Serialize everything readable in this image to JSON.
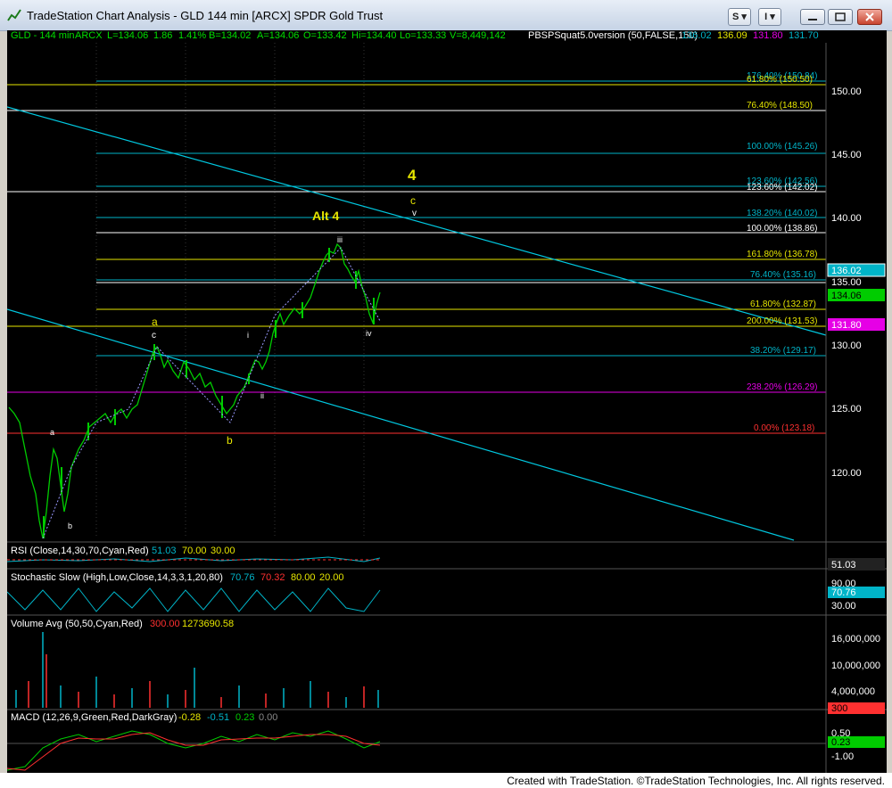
{
  "window": {
    "title": "TradeStation Chart Analysis - GLD 144 min [ARCX] SPDR Gold Trust",
    "s_button": "S",
    "i_button": "I"
  },
  "header": {
    "symbol": "GLD - 144 min",
    "exchange": "ARCX",
    "last": "L=134.06",
    "chg": "1.86",
    "pct": "1.41%",
    "bid": "B=134.02",
    "ask": "A=134.06",
    "open": "O=133.42",
    "high": "Hi=134.40",
    "low": "Lo=133.33",
    "volume": "V=8,449,142",
    "study": "PBSPSquat5.0version (50,FALSE,150)",
    "v1": "136.02",
    "v2": "136.09",
    "v3": "131.80",
    "v4": "131.70"
  },
  "colors": {
    "up": "#00cc00",
    "cyan": "#00b4c8",
    "yellow": "#e6e600",
    "magenta": "#e600e6",
    "red": "#ff3030",
    "white": "#ffffff"
  },
  "price_axis": [
    "150.00",
    "145.00",
    "140.00",
    "135.00",
    "130.00",
    "125.00",
    "120.00"
  ],
  "fib_labels": [
    {
      "text": "176.40% (150.84)",
      "color": "#00b4c8"
    },
    {
      "text": "61.80% (150.50)",
      "color": "#e6e600"
    },
    {
      "text": "76.40% (148.50)",
      "color": "#e6e600"
    },
    {
      "text": "100.00% (145.26)",
      "color": "#00b4c8"
    },
    {
      "text": "123.60% (142.56)",
      "color": "#00b4c8"
    },
    {
      "text": "123.60% (142.02)",
      "color": "#ffffff"
    },
    {
      "text": "138.20% (140.02)",
      "color": "#00b4c8"
    },
    {
      "text": "100.00% (138.86)",
      "color": "#ffffff"
    },
    {
      "text": "161.80% (136.78)",
      "color": "#e6e600"
    },
    {
      "text": "76.40% (135.16)",
      "color": "#00b4c8"
    },
    {
      "text": "61.80% (132.87)",
      "color": "#e6e600"
    },
    {
      "text": "200.00% (131.53)",
      "color": "#e6e600"
    },
    {
      "text": "38.20% (129.17)",
      "color": "#00b4c8"
    },
    {
      "text": "238.20% (126.29)",
      "color": "#e600e6"
    },
    {
      "text": "0.00% (123.18)",
      "color": "#ff3030"
    }
  ],
  "wave_labels": {
    "big_4": "4",
    "c_upper": "c",
    "v_upper": "v",
    "alt_4": "Alt 4",
    "iii": "iii",
    "iv": "iv",
    "i": "i",
    "ii": "ii",
    "a_yellow": "a",
    "c_white": "c",
    "b_yellow": "b",
    "a_small": "a",
    "b_small": "b"
  },
  "price_tags": {
    "tag1": "136.02",
    "tag2": "134.06",
    "tag3": "131.80"
  },
  "rsi": {
    "label": "RSI (Close,14,30,70,Cyan,Red)",
    "value": "51.03",
    "ob": "70.00",
    "os": "30.00",
    "tag": "51.03"
  },
  "stoch": {
    "label": "Stochastic Slow (High,Low,Close,14,3,3,1,20,80)",
    "k": "70.76",
    "d": "70.32",
    "ob": "80.00",
    "os": "20.00",
    "axis_90": "90.00",
    "tag": "70.76",
    "axis_30": "30.00"
  },
  "volume": {
    "label": "Volume Avg (50,50,Cyan,Red)",
    "v1": "300.00",
    "v2": "1273690.58",
    "axis": [
      "16,000,000",
      "10,000,000",
      "4,000,000"
    ],
    "tag": "300"
  },
  "macd": {
    "label": "MACD (12,26,9,Green,Red,DarkGray)",
    "m": "-0.28",
    "s": "-0.51",
    "h": "0.23",
    "z": "0.00",
    "axis_top": "0.50",
    "tag": "0.23",
    "axis_bottom": "-1.00"
  },
  "status": "Created with TradeStation. ©TradeStation Technologies, Inc. All rights reserved."
}
